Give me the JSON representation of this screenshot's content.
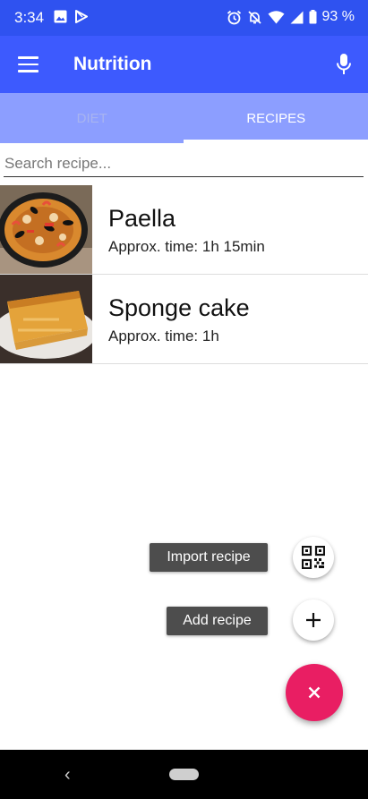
{
  "status_bar": {
    "time": "3:34",
    "battery": "93 %"
  },
  "app_bar": {
    "title": "Nutrition"
  },
  "tabs": [
    {
      "label": "DIET"
    },
    {
      "label": "RECIPES"
    }
  ],
  "search": {
    "placeholder": "Search recipe..."
  },
  "recipes": [
    {
      "name": "Paella",
      "time": "Approx. time: 1h 15min"
    },
    {
      "name": "Sponge cake",
      "time": "Approx. time: 1h"
    }
  ],
  "fab_menu": {
    "import_label": "Import recipe",
    "add_label": "Add recipe"
  },
  "colors": {
    "status_bar": "#2f52f0",
    "app_bar": "#3d5afe",
    "tab_bar": "#8c9eff",
    "fab": "#e91e63",
    "label_bg": "#4d4d4d"
  },
  "icons": [
    "image-icon",
    "play-store-icon",
    "alarm-icon",
    "notifications-off-icon",
    "wifi-icon",
    "signal-icon",
    "battery-icon",
    "menu-icon",
    "mic-icon",
    "qr-code-icon",
    "plus-icon",
    "close-icon",
    "back-icon",
    "home-icon"
  ]
}
